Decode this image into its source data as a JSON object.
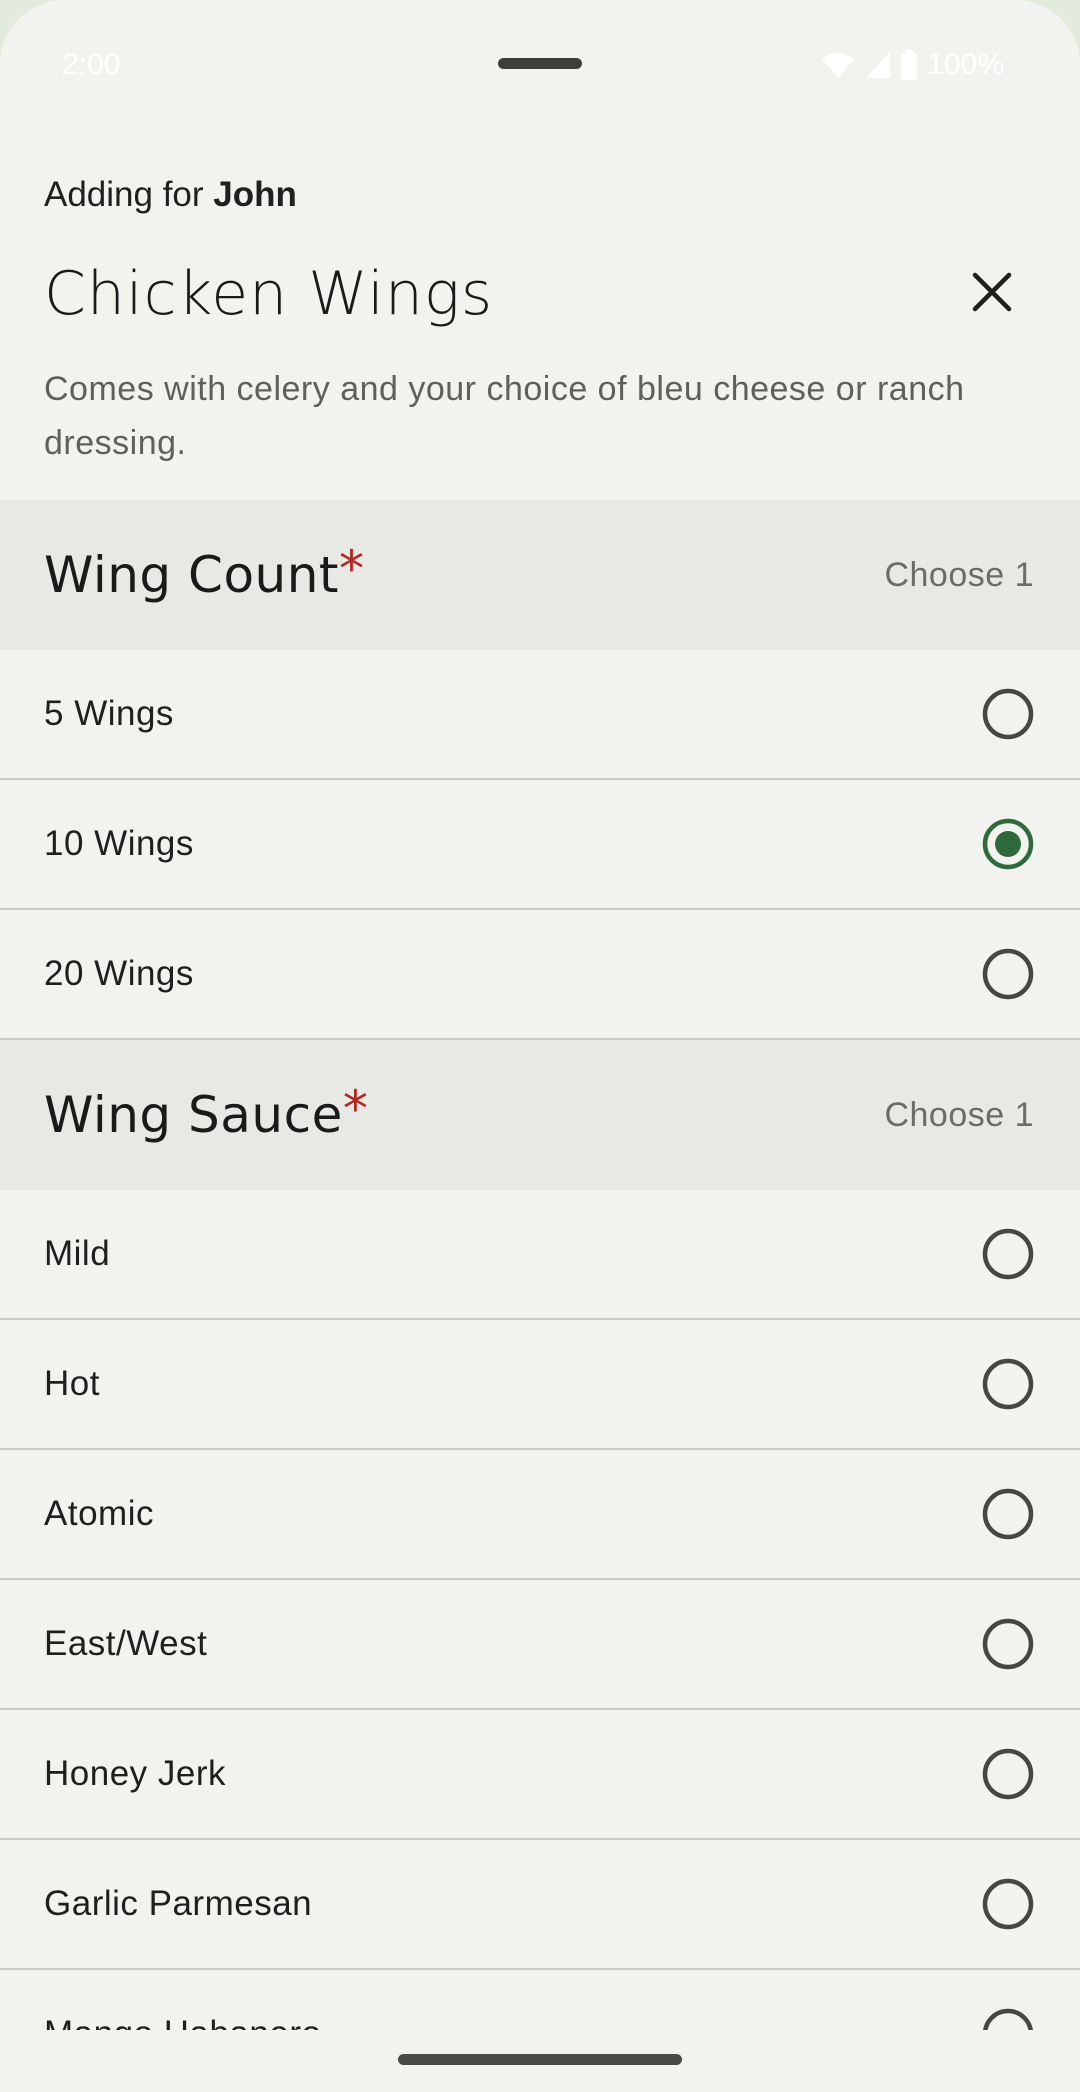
{
  "status_bar": {
    "time": "2:00",
    "battery": "100%"
  },
  "header": {
    "adding_for_prefix": "Adding for ",
    "adding_for_name": "John",
    "title": "Chicken Wings",
    "close_icon": "close-icon",
    "description": "Comes with celery and your choice of bleu cheese or ranch dressing."
  },
  "sections": [
    {
      "title": "Wing Count",
      "required_marker": "*",
      "choose_label": "Choose 1",
      "options": [
        {
          "label": "5 Wings",
          "selected": false
        },
        {
          "label": "10 Wings",
          "selected": true
        },
        {
          "label": "20 Wings",
          "selected": false
        }
      ]
    },
    {
      "title": "Wing Sauce",
      "required_marker": "*",
      "choose_label": "Choose 1",
      "options": [
        {
          "label": "Mild",
          "selected": false
        },
        {
          "label": "Hot",
          "selected": false
        },
        {
          "label": "Atomic",
          "selected": false
        },
        {
          "label": "East/West",
          "selected": false
        },
        {
          "label": "Honey Jerk",
          "selected": false
        },
        {
          "label": "Garlic Parmesan",
          "selected": false
        },
        {
          "label": "Mango Habanero",
          "selected": false
        }
      ]
    }
  ],
  "colors": {
    "accent": "#2f6a3c",
    "radio_border": "#444746",
    "required": "#b3261e",
    "background": "#f2f3ee",
    "section_header_bg": "#e8e9e4"
  }
}
